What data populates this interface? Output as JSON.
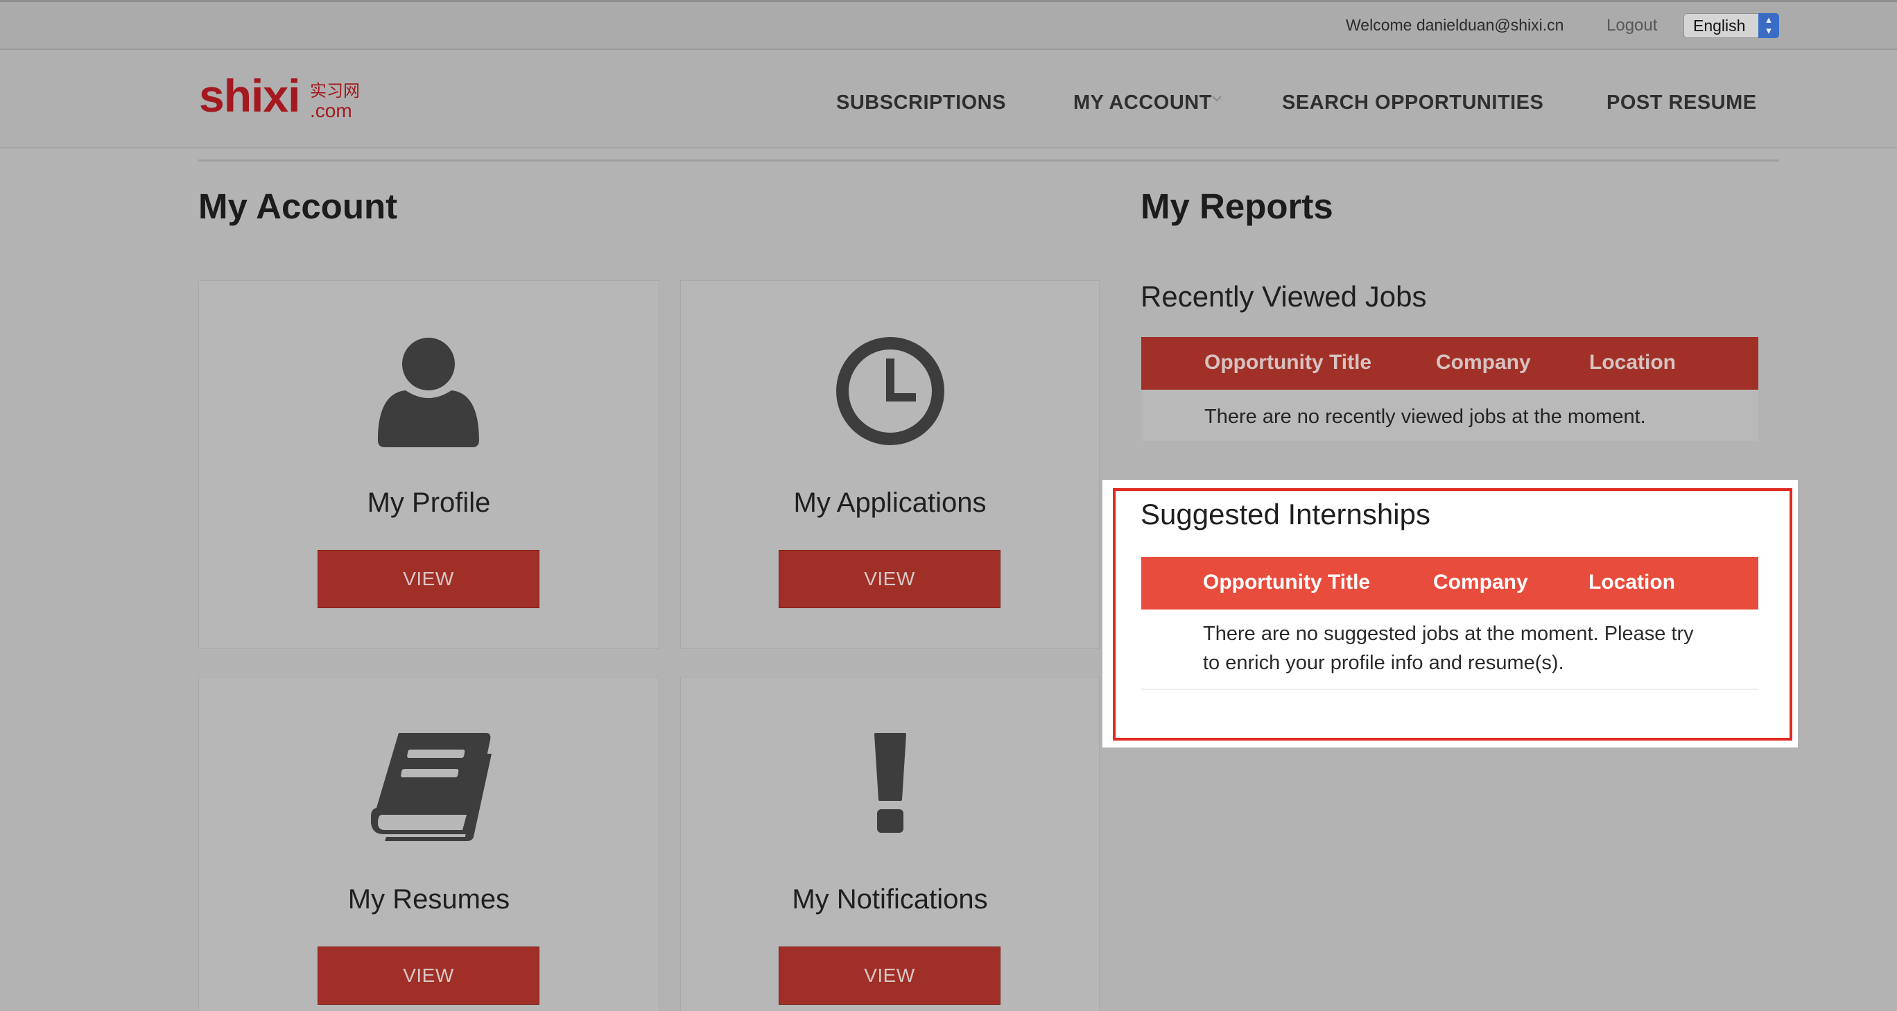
{
  "topbar": {
    "welcome_text": "Welcome danielduan@shixi.cn",
    "logout_label": "Logout",
    "language": "English"
  },
  "logo": {
    "text": "shixi",
    "cn_text": "实习网",
    "domain": ".com",
    "color": "#a3191f"
  },
  "nav": {
    "subscriptions": "SUBSCRIPTIONS",
    "my_account": "MY ACCOUNT",
    "search": "SEARCH OPPORTUNITIES",
    "post_resume": "POST RESUME"
  },
  "account": {
    "heading": "My Account",
    "cards": [
      {
        "title": "My Profile",
        "icon": "user-icon",
        "button": "VIEW"
      },
      {
        "title": "My Applications",
        "icon": "clock-icon",
        "button": "VIEW"
      },
      {
        "title": "My Resumes",
        "icon": "book-icon",
        "button": "VIEW"
      },
      {
        "title": "My Notifications",
        "icon": "exclamation-icon",
        "button": "VIEW"
      }
    ]
  },
  "reports": {
    "heading": "My Reports",
    "recently_viewed": {
      "title": "Recently Viewed Jobs",
      "columns": [
        "Opportunity Title",
        "Company",
        "Location"
      ],
      "empty_message": "There are no recently viewed jobs at the moment."
    },
    "suggested": {
      "title": "Suggested Internships",
      "columns": [
        "Opportunity Title",
        "Company",
        "Location"
      ],
      "empty_message": "There are no suggested jobs at the moment. Please try to enrich your profile info and resume(s)."
    }
  },
  "colors": {
    "brand_red": "#e84c3d",
    "dimmed_red": "#a13128",
    "highlight_border": "#e02a21",
    "overlay_gray": "#b3b3b3"
  }
}
